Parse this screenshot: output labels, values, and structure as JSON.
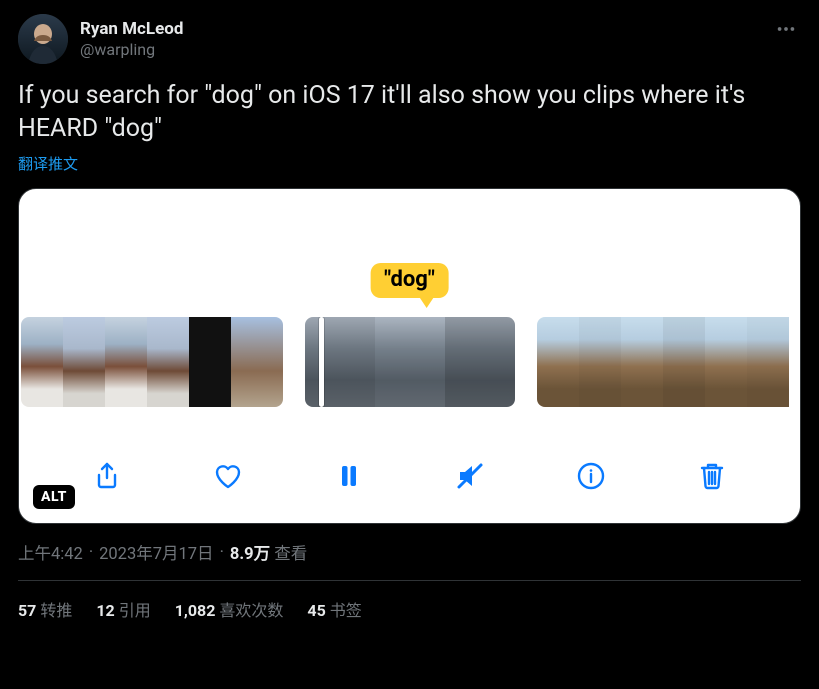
{
  "user": {
    "display_name": "Ryan McLeod",
    "handle": "@warpling"
  },
  "tweet": {
    "text": "If you search for \"dog\" on iOS 17 it'll also show you clips where it's HEARD \"dog\"",
    "translate_label": "翻译推文",
    "bubble_text": "\"dog\"",
    "alt_badge": "ALT"
  },
  "meta": {
    "time": "上午4:42",
    "sep1": "·",
    "date": "2023年7月17日",
    "sep2": "·",
    "views_number": "8.9万",
    "views_label": "查看"
  },
  "stats": {
    "retweets_n": "57",
    "retweets_label": "转推",
    "quotes_n": "12",
    "quotes_label": "引用",
    "likes_n": "1,082",
    "likes_label": "喜欢次数",
    "bookmarks_n": "45",
    "bookmarks_label": "书签"
  }
}
